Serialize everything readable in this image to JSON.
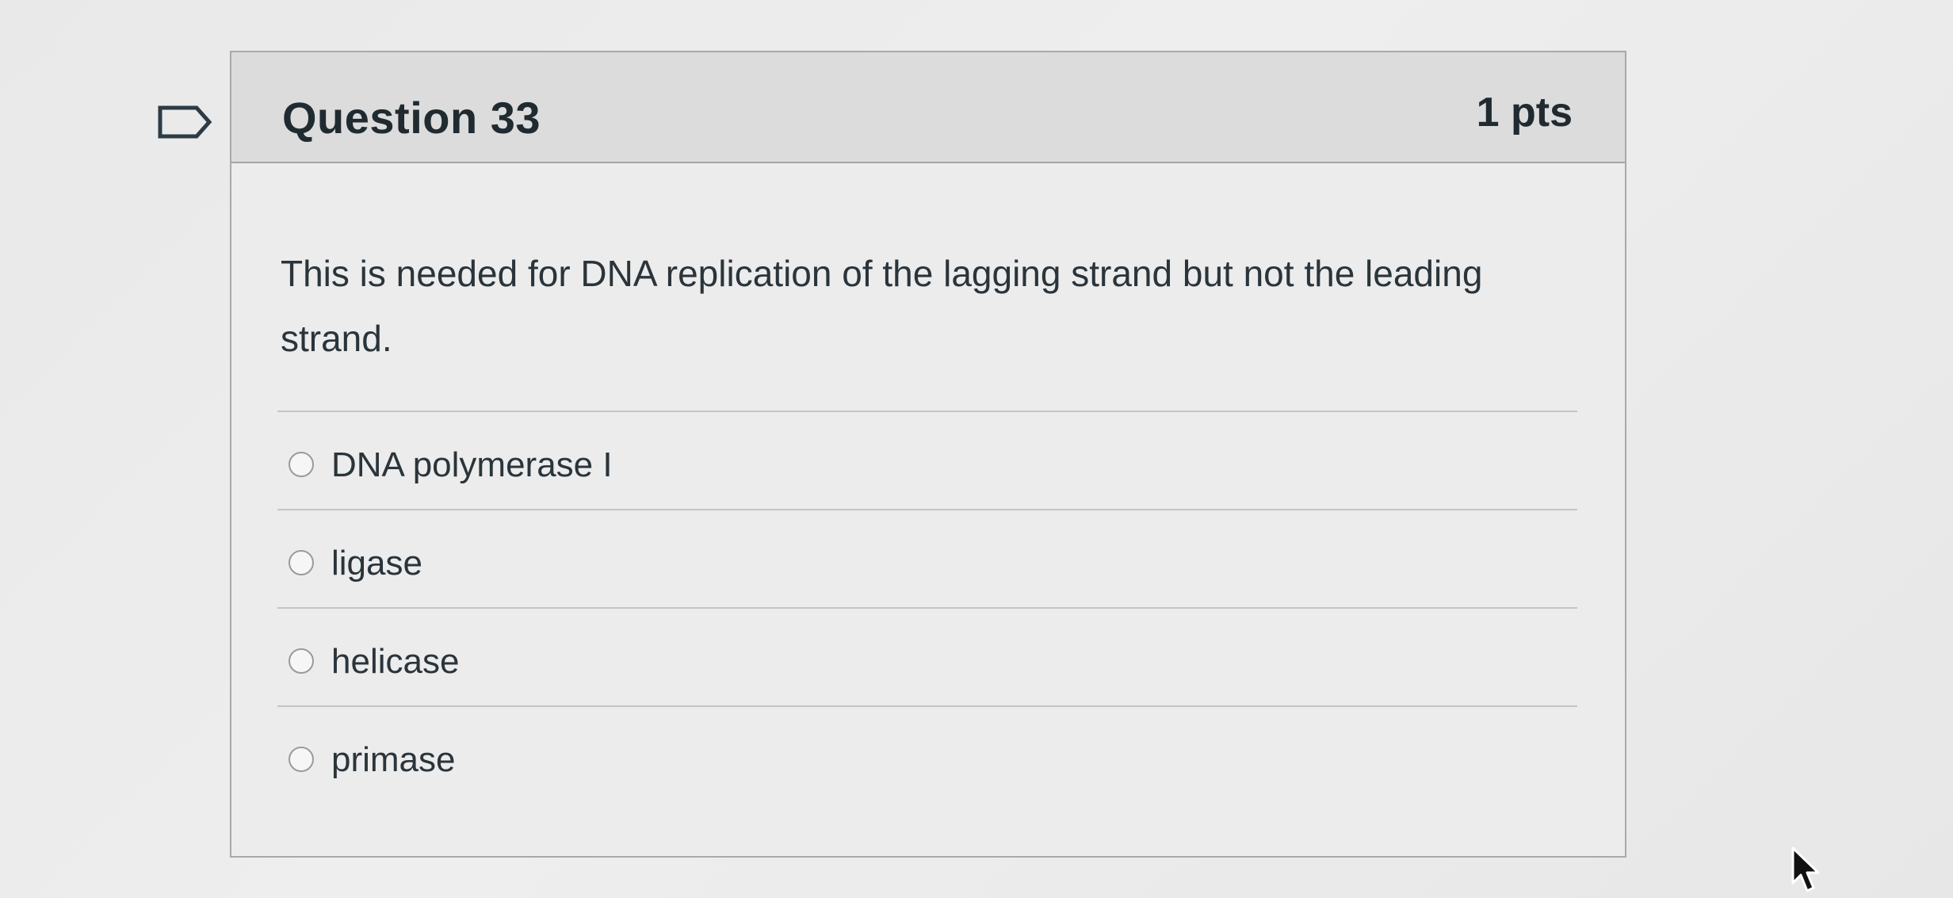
{
  "question": {
    "title": "Question 33",
    "points": "1 pts",
    "text": "This is needed for DNA replication of the lagging strand but not the leading strand."
  },
  "answers": [
    {
      "label": "DNA polymerase I"
    },
    {
      "label": "ligase"
    },
    {
      "label": "helicase"
    },
    {
      "label": "primase"
    }
  ],
  "icons": {
    "flag": "flag-question-icon",
    "cursor": "mouse-pointer-icon"
  },
  "colors": {
    "header_bg": "#dcdcdc",
    "card_border": "#a9a9a9",
    "text": "#2a343b"
  }
}
